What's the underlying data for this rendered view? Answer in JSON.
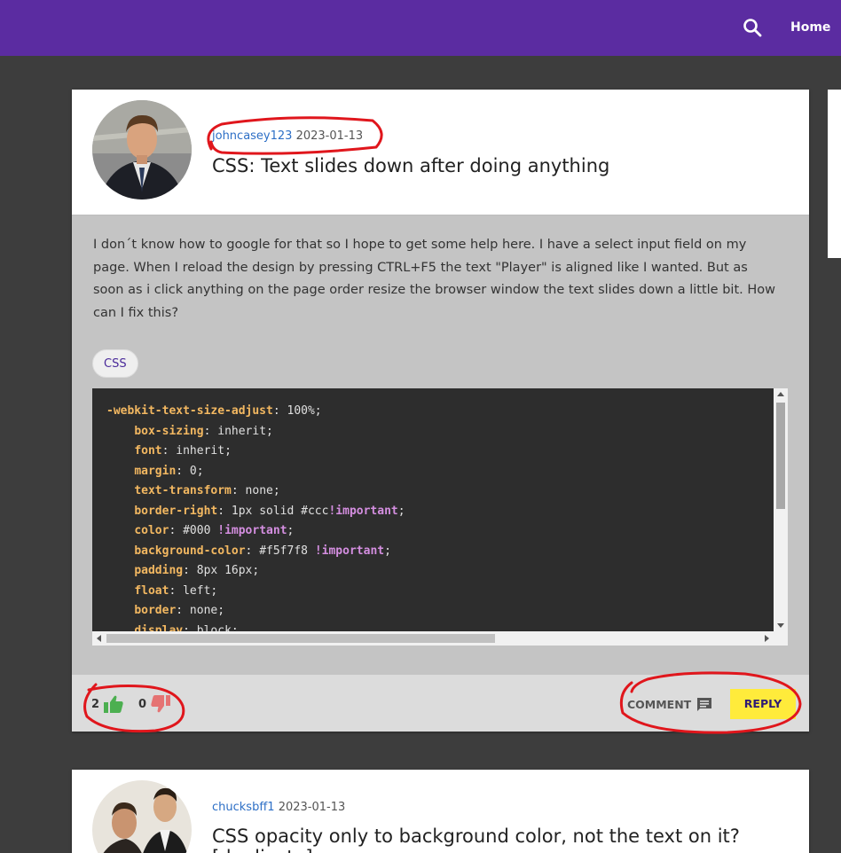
{
  "header": {
    "search_icon": "search-icon",
    "home_label": "Home"
  },
  "posts": [
    {
      "user": "johncasey123",
      "date": "2023-01-13",
      "title": "CSS: Text slides down after doing anything",
      "description": "I don´t know how to google for that so I hope to get some help here. I have a select input field on my page. When I reload the design by pressing CTRL+F5 the text \"Player\" is aligned like I wanted. But as soon as i click anything on the page order resize the browser window the text slides down a little bit. How can I fix this?",
      "tag": "CSS",
      "code_lines": [
        "-webkit-text-size-adjust: 100%;",
        "    box-sizing: inherit;",
        "    font: inherit;",
        "    margin: 0;",
        "    text-transform: none;",
        "    border-right: 1px solid #ccc!important;",
        "    color: #000 !important;",
        "    background-color: #f5f7f8 !important;",
        "    padding: 8px 16px;",
        "    float: left;",
        "    border: none;",
        "    display: block;"
      ],
      "upvotes": "2",
      "downvotes": "0",
      "comment_label": "COMMENT",
      "reply_label": "REPLY"
    },
    {
      "user": "chucksbff1",
      "date": "2023-01-13",
      "title": "CSS opacity only to background color, not the text on it? [duplicate]"
    }
  ],
  "colors": {
    "header": "#5b2ca1",
    "reply_button": "#ffeb3b",
    "upvote": "#4caf50",
    "downvote": "#e57373",
    "annotation": "#e0161c"
  }
}
